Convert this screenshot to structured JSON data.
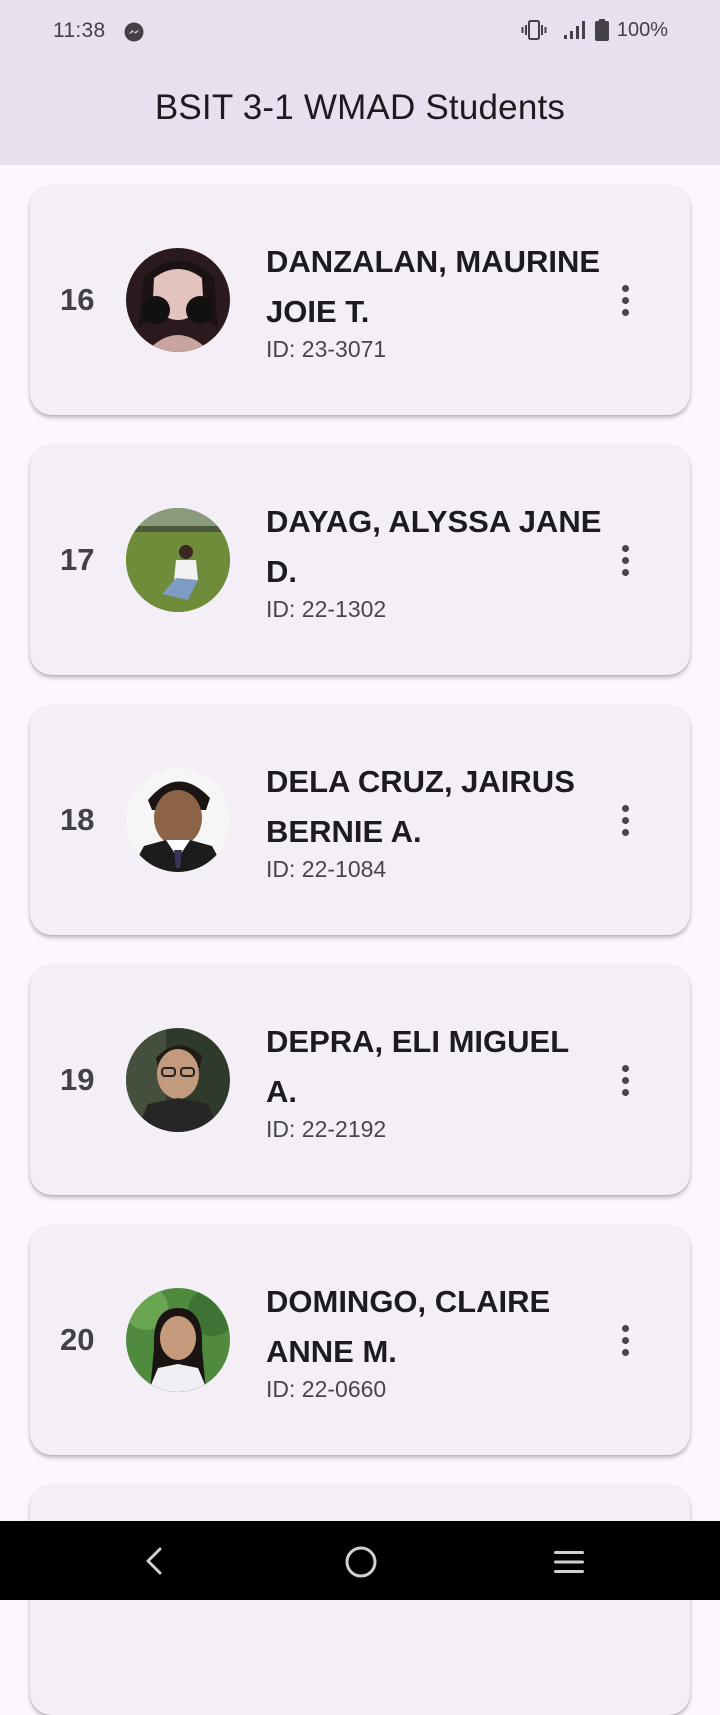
{
  "status_bar": {
    "time": "11:38",
    "battery": "100%",
    "icons": [
      "messenger-icon",
      "vibrate-icon",
      "signal-icon",
      "battery-icon"
    ]
  },
  "app_bar": {
    "title": "BSIT 3-1 WMAD Students",
    "background": "#e8e0ef"
  },
  "students": [
    {
      "number": "16",
      "name": "DANZALAN, MAURINE JOIE T.",
      "id": "ID: 23-3071"
    },
    {
      "number": "17",
      "name": "DAYAG, ALYSSA JANE D.",
      "id": "ID: 22-1302"
    },
    {
      "number": "18",
      "name": "DELA CRUZ, JAIRUS BERNIE A.",
      "id": "ID: 22-1084"
    },
    {
      "number": "19",
      "name": "DEPRA, ELI MIGUEL A.",
      "id": "ID: 22-2192"
    },
    {
      "number": "20",
      "name": "DOMINGO, CLAIRE ANNE M.",
      "id": "ID: 22-0660"
    }
  ],
  "colors": {
    "card": "#f4eff6",
    "page": "#fcf7fd",
    "text": "#1d1b20"
  },
  "nav_bar": {
    "icons": [
      "back-icon",
      "home-icon",
      "recents-icon"
    ]
  }
}
